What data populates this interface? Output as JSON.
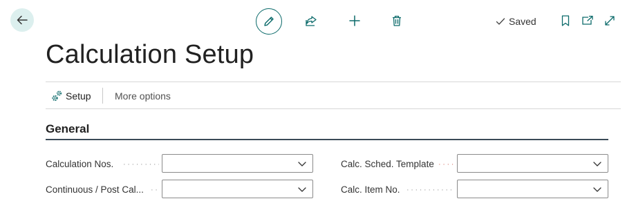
{
  "toolbar": {
    "back_icon": "arrow-left-icon",
    "edit_icon": "pencil-icon",
    "share_icon": "share-icon",
    "new_icon": "plus-icon",
    "delete_icon": "trash-icon",
    "saved_label": "Saved",
    "bookmark_icon": "bookmark-icon",
    "open_new_window_icon": "open-in-new-window-icon",
    "expand_icon": "expand-icon"
  },
  "page": {
    "title": "Calculation Setup"
  },
  "actions": {
    "setup_label": "Setup",
    "more_options_label": "More options"
  },
  "section": {
    "title": "General",
    "fields_left": [
      {
        "label": "Calculation Nos.",
        "value": ""
      },
      {
        "label": "Continuous / Post Cal...",
        "value": ""
      }
    ],
    "fields_right": [
      {
        "label": "Calc. Sched. Template",
        "value": ""
      },
      {
        "label": "Calc. Item No.",
        "value": ""
      }
    ]
  },
  "colors": {
    "accent": "#0b6a6a",
    "back_bg": "#dcefee",
    "section_line": "#3a4a57"
  }
}
